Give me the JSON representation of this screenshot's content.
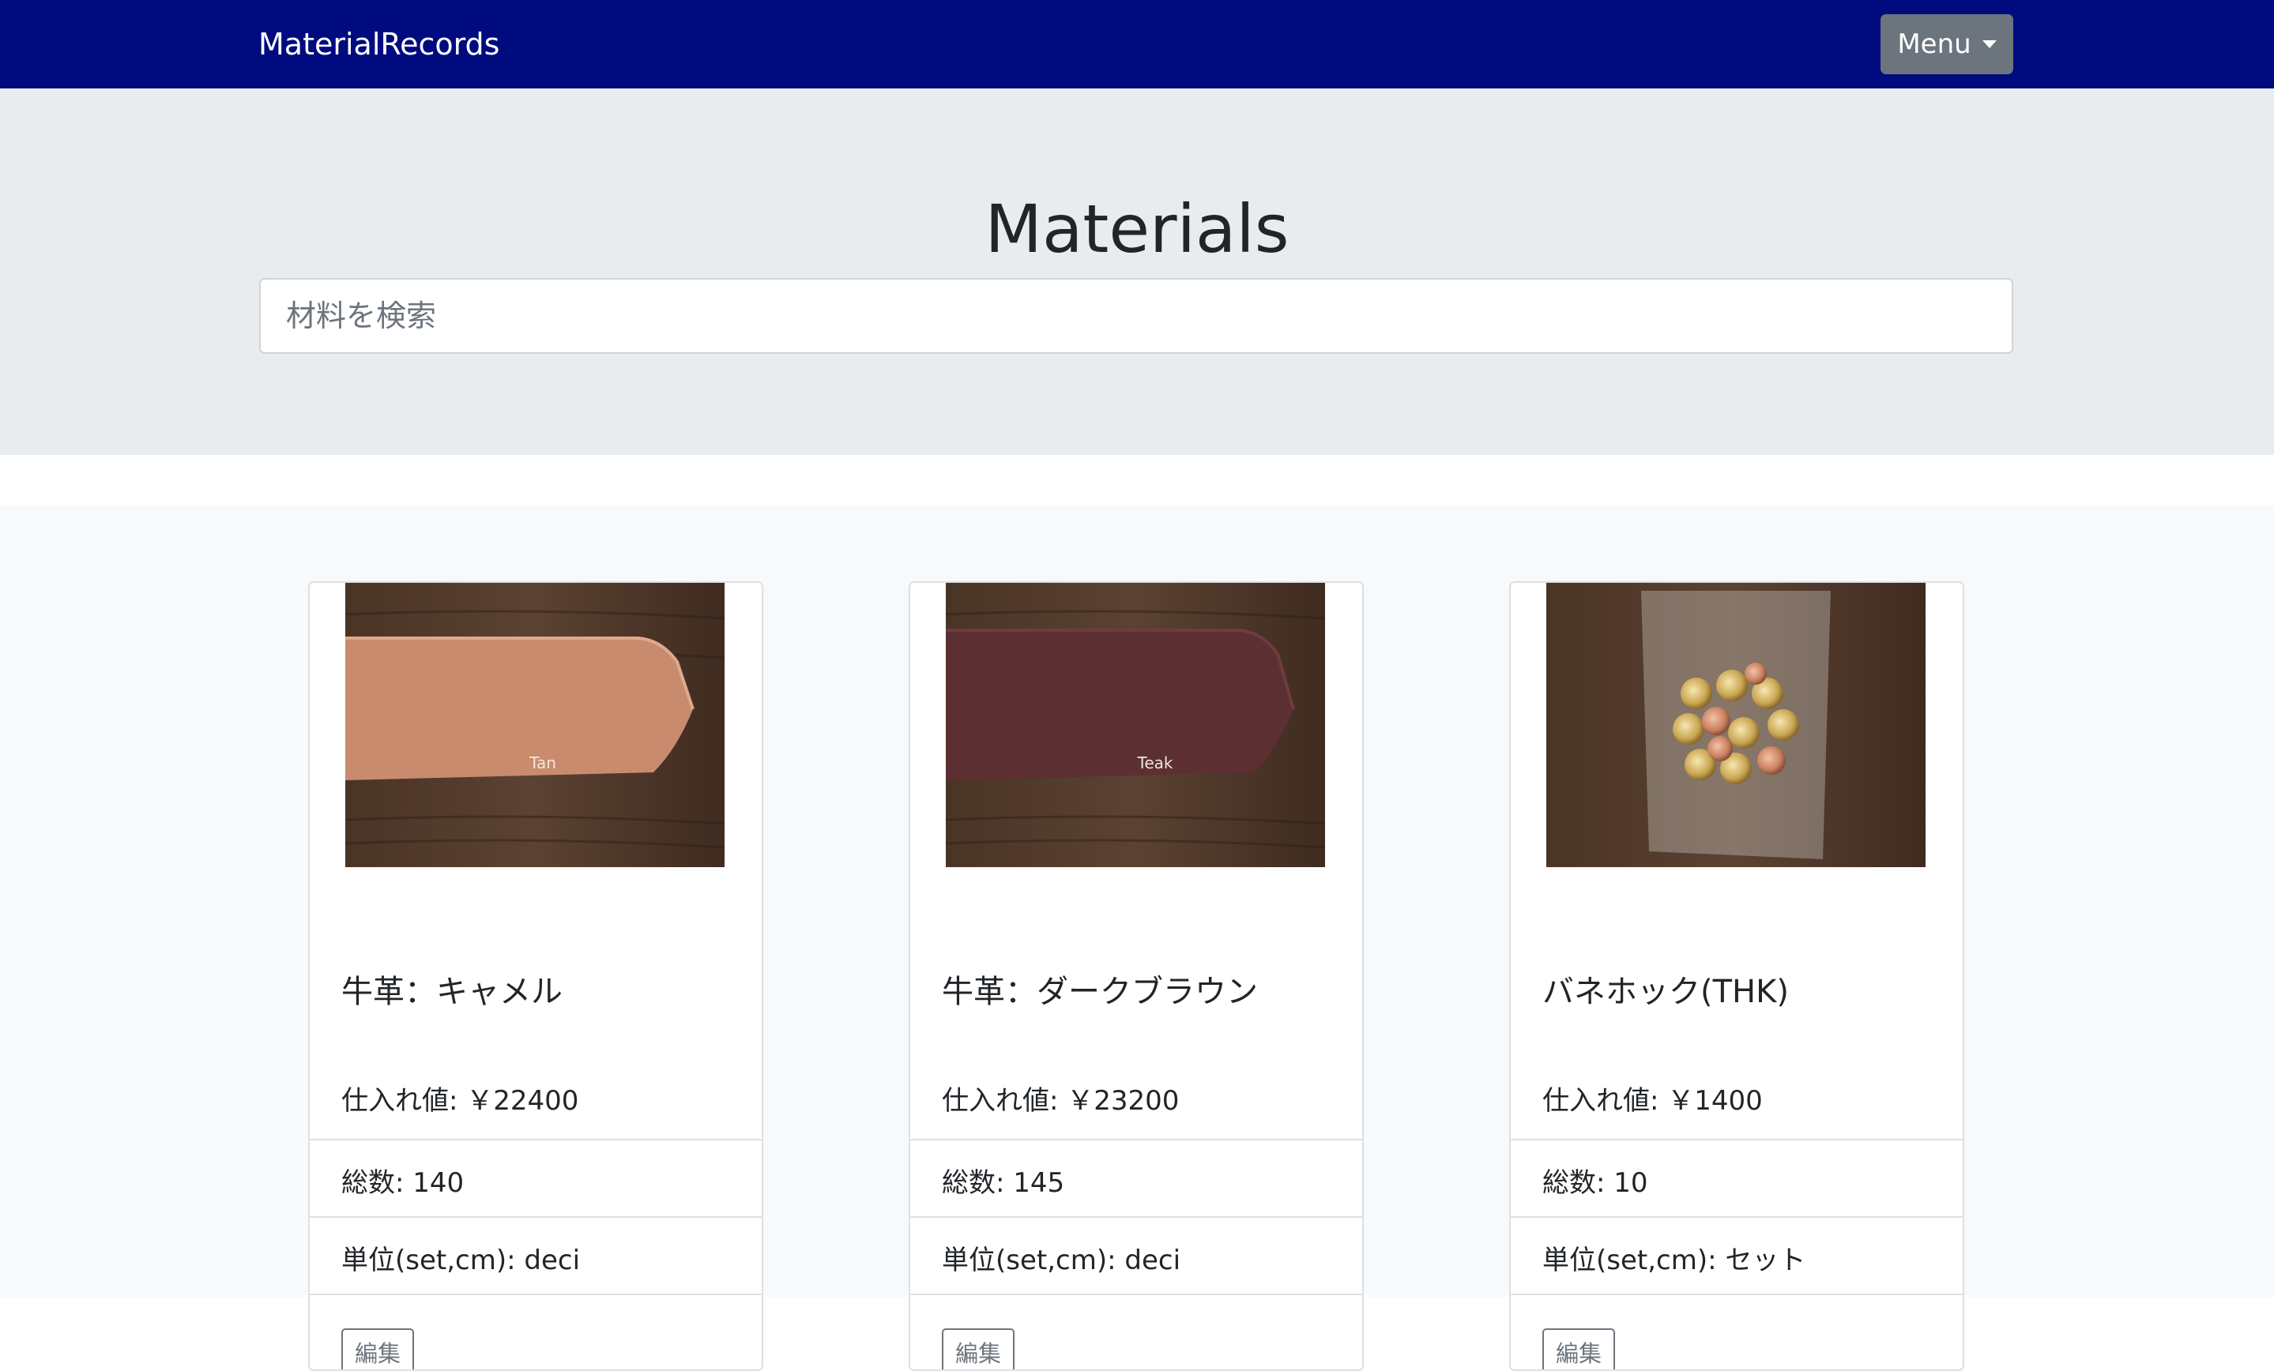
{
  "navbar": {
    "brand": "MaterialRecords",
    "menu_label": "Menu"
  },
  "hero": {
    "title": "Materials",
    "search_placeholder": "材料を検索"
  },
  "cards": [
    {
      "image_label": "Tan",
      "name": "牛革：キャメル",
      "price": "仕入れ値: ￥22400",
      "total": "総数: 140",
      "unit": "単位(set,cm): deci",
      "edit_label": "編集",
      "leather_color": "#c98b6e"
    },
    {
      "image_label": "Teak",
      "name": "牛革：ダークブラウン",
      "price": "仕入れ値: ￥23200",
      "total": "総数: 145",
      "unit": "単位(set,cm): deci",
      "edit_label": "編集",
      "leather_color": "#5c2f33"
    },
    {
      "image_label": "",
      "name": "バネホック(THK)",
      "price": "仕入れ値: ￥1400",
      "total": "総数: 10",
      "unit": "単位(set,cm): セット",
      "edit_label": "編集"
    }
  ]
}
